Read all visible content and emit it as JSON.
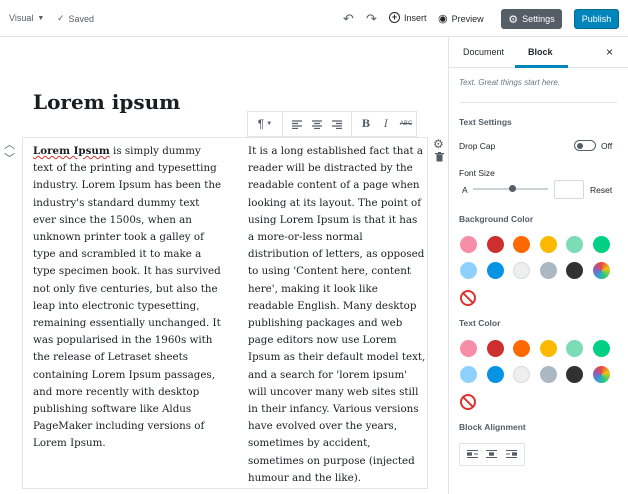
{
  "topbar": {
    "mode_label": "Visual",
    "saved_label": "Saved",
    "insert_label": "Insert",
    "preview_label": "Preview",
    "settings_label": "Settings",
    "publish_label": "Publish"
  },
  "post": {
    "title": "Lorem ipsum",
    "col1": "is simply dummy text of the printing and typesetting industry. Lorem Ipsum has been the industry's standard dummy text ever since the 1500s, when an unknown printer took a galley of type and scrambled it to make a type specimen book. It has survived not only five centuries, but also the leap into electronic typesetting, remaining essentially unchanged. It was popularised in the 1960s with the release of Letraset sheets containing Lorem Ipsum passages, and more recently with desktop publishing software like Aldus PageMaker including versions of Lorem Ipsum.",
    "col1_lead": "Lorem Ipsum",
    "col2": "It is a long established fact that a reader will be distracted by the readable content of a page when looking at its layout. The point of using Lorem Ipsum is that it has a more-or-less normal distribution of letters, as opposed to using 'Content here, content here', making it look like readable English. Many desktop publishing packages and web page editors now use Lorem Ipsum as their default model text, and a search for 'lorem ipsum' will uncover many web sites still in their infancy. Various versions have evolved over the years, sometimes by accident, sometimes on purpose (injected humour and the like)."
  },
  "block_toolbar": {
    "para_icon": "¶",
    "bold": "B",
    "italic": "I",
    "strike": "ABC"
  },
  "sidebar": {
    "tab_document": "Document",
    "tab_block": "Block",
    "close": "×",
    "description": "Text. Great things start here.",
    "text_settings_title": "Text Settings",
    "drop_cap_label": "Drop Cap",
    "drop_cap_state": "Off",
    "font_size_label": "Font Size",
    "font_size_glyph": "A",
    "font_size_value": "",
    "reset_label": "Reset",
    "bg_color_title": "Background Color",
    "text_color_title": "Text Color",
    "block_alignment_title": "Block Alignment",
    "swatches": [
      "#f78da7",
      "#cf2e2e",
      "#ff6900",
      "#fcb900",
      "#7bdcb5",
      "#00d084",
      "#8ed1fc",
      "#0693e3",
      "#eeeeee",
      "#abb8c3",
      "#313131",
      "custom-gradient"
    ]
  }
}
